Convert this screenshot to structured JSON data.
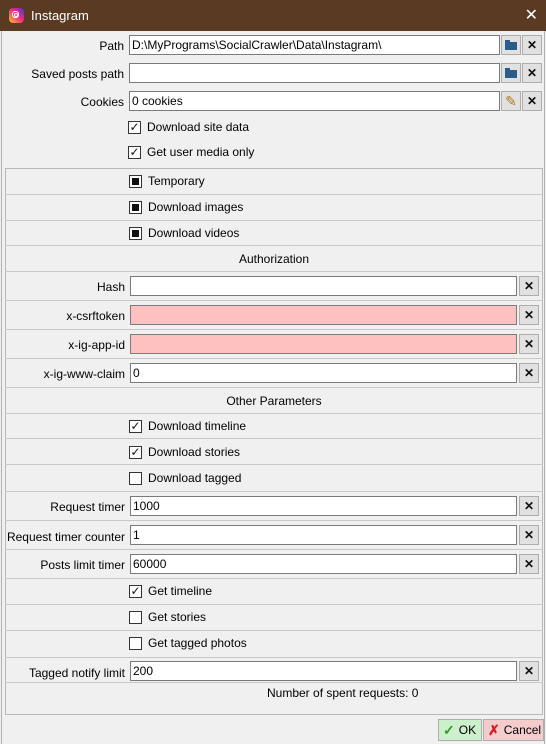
{
  "window": {
    "title": "Instagram",
    "close_glyph": "✕"
  },
  "path": {
    "label": "Path",
    "value": "D:\\MyPrograms\\SocialCrawler\\Data\\Instagram\\"
  },
  "saved_posts_path": {
    "label": "Saved posts path",
    "value": ""
  },
  "cookies": {
    "label": "Cookies",
    "value": "0 cookies"
  },
  "download_site_data": {
    "label": "Download site data",
    "checked": true
  },
  "get_user_media_only": {
    "label": "Get user media only",
    "checked": true
  },
  "temporary": {
    "label": "Temporary",
    "state": "indeterminate"
  },
  "download_images": {
    "label": "Download images",
    "state": "indeterminate"
  },
  "download_videos": {
    "label": "Download videos",
    "state": "indeterminate"
  },
  "authorization": {
    "header": "Authorization",
    "hash": {
      "label": "Hash",
      "value": ""
    },
    "csrftoken": {
      "label": "x-csrftoken",
      "value": ""
    },
    "app_id": {
      "label": "x-ig-app-id",
      "value": ""
    },
    "www_claim": {
      "label": "x-ig-www-claim",
      "value": "0"
    }
  },
  "other": {
    "header": "Other Parameters",
    "download_timeline": {
      "label": "Download timeline",
      "checked": true
    },
    "download_stories": {
      "label": "Download stories",
      "checked": true
    },
    "download_tagged": {
      "label": "Download tagged",
      "checked": false
    },
    "request_timer": {
      "label": "Request timer",
      "value": "1000"
    },
    "request_timer_counter": {
      "label": "Request timer counter",
      "value": "1"
    },
    "posts_limit_timer": {
      "label": "Posts limit timer",
      "value": "60000"
    },
    "get_timeline": {
      "label": "Get timeline",
      "checked": true
    },
    "get_stories": {
      "label": "Get stories",
      "checked": false
    },
    "get_tagged_photos": {
      "label": "Get tagged photos",
      "checked": false
    },
    "tagged_notify_limit": {
      "label": "Tagged notify limit",
      "value": "200"
    },
    "spent_requests": "Number of spent requests: 0"
  },
  "footer": {
    "ok_label": "OK",
    "cancel_label": "Cancel"
  },
  "colors": {
    "titlebar": "#5a3a22",
    "required_field": "#ffc0c0",
    "ok_bg": "#ccefcc",
    "cancel_bg": "#f4cccc"
  },
  "icons": {
    "clear": "✕",
    "pencil": "✎",
    "ok": "✓",
    "cancel": "✗",
    "checked": "✓"
  }
}
